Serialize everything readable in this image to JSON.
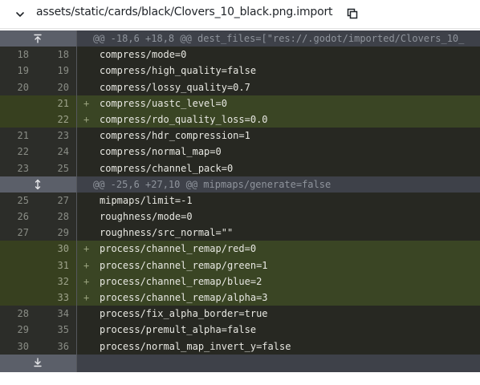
{
  "file": {
    "path": "assets/static/cards/black/Clovers_10_black.png.import"
  },
  "hunks": [
    {
      "header": "@@ -18,6 +18,8 @@ dest_files=[\"res://.godot/imported/Clovers_10_",
      "expand_icon": "expand-up-icon",
      "lines": [
        {
          "type": "ctx",
          "old": "18",
          "new": "18",
          "sign": "",
          "text": "compress/mode=0"
        },
        {
          "type": "ctx",
          "old": "19",
          "new": "19",
          "sign": "",
          "text": "compress/high_quality=false"
        },
        {
          "type": "ctx",
          "old": "20",
          "new": "20",
          "sign": "",
          "text": "compress/lossy_quality=0.7"
        },
        {
          "type": "add",
          "old": "",
          "new": "21",
          "sign": "+",
          "text": "compress/uastc_level=0"
        },
        {
          "type": "add",
          "old": "",
          "new": "22",
          "sign": "+",
          "text": "compress/rdo_quality_loss=0.0"
        },
        {
          "type": "ctx",
          "old": "21",
          "new": "23",
          "sign": "",
          "text": "compress/hdr_compression=1"
        },
        {
          "type": "ctx",
          "old": "22",
          "new": "24",
          "sign": "",
          "text": "compress/normal_map=0"
        },
        {
          "type": "ctx",
          "old": "23",
          "new": "25",
          "sign": "",
          "text": "compress/channel_pack=0"
        }
      ]
    },
    {
      "header": "@@ -25,6 +27,10 @@ mipmaps/generate=false",
      "expand_icon": "expand-both-icon",
      "lines": [
        {
          "type": "ctx",
          "old": "25",
          "new": "27",
          "sign": "",
          "text": "mipmaps/limit=-1"
        },
        {
          "type": "ctx",
          "old": "26",
          "new": "28",
          "sign": "",
          "text": "roughness/mode=0"
        },
        {
          "type": "ctx",
          "old": "27",
          "new": "29",
          "sign": "",
          "text": "roughness/src_normal=\"\""
        },
        {
          "type": "add",
          "old": "",
          "new": "30",
          "sign": "+",
          "text": "process/channel_remap/red=0"
        },
        {
          "type": "add",
          "old": "",
          "new": "31",
          "sign": "+",
          "text": "process/channel_remap/green=1"
        },
        {
          "type": "add",
          "old": "",
          "new": "32",
          "sign": "+",
          "text": "process/channel_remap/blue=2"
        },
        {
          "type": "add",
          "old": "",
          "new": "33",
          "sign": "+",
          "text": "process/channel_remap/alpha=3"
        },
        {
          "type": "ctx",
          "old": "28",
          "new": "34",
          "sign": "",
          "text": "process/fix_alpha_border=true"
        },
        {
          "type": "ctx",
          "old": "29",
          "new": "35",
          "sign": "",
          "text": "process/premult_alpha=false"
        },
        {
          "type": "ctx",
          "old": "30",
          "new": "36",
          "sign": "",
          "text": "process/normal_map_invert_y=false"
        }
      ]
    }
  ],
  "footer": {
    "expand_icon": "expand-down-icon"
  },
  "colors": {
    "context_bg": "#272822",
    "added_bg": "#3a4524",
    "hunk_bg": "#3e4149"
  }
}
